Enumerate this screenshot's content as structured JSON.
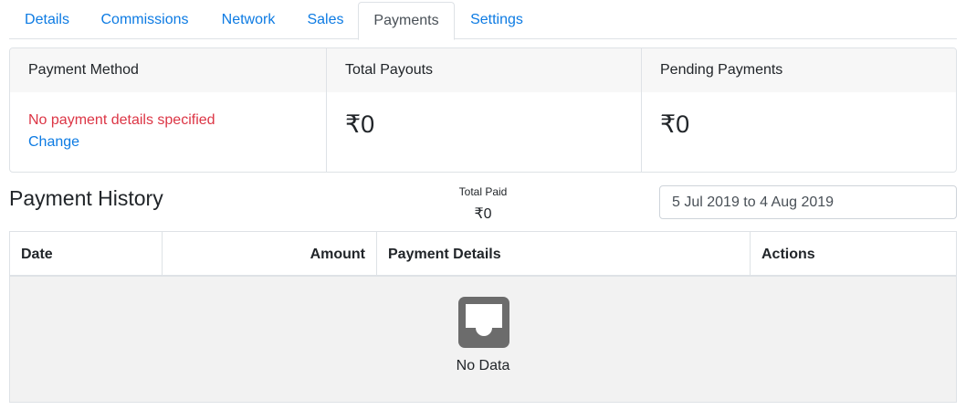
{
  "tabs": [
    {
      "label": "Details"
    },
    {
      "label": "Commissions"
    },
    {
      "label": "Network"
    },
    {
      "label": "Sales"
    },
    {
      "label": "Payments",
      "active": true
    },
    {
      "label": "Settings"
    }
  ],
  "summary": {
    "payment_method": {
      "heading": "Payment Method",
      "warning": "No payment details specified",
      "change_link": "Change"
    },
    "total_payouts": {
      "heading": "Total Payouts",
      "value": "₹0"
    },
    "pending_payments": {
      "heading": "Pending Payments",
      "value": "₹0"
    }
  },
  "history": {
    "title": "Payment History",
    "total_paid_label": "Total Paid",
    "total_paid_value": "₹0",
    "date_range": "5 Jul 2019 to 4 Aug 2019"
  },
  "table": {
    "columns": [
      "Date",
      "Amount",
      "Payment Details",
      "Actions"
    ],
    "rows": [],
    "empty_text": "No Data",
    "empty_icon": "inbox-icon"
  },
  "colors": {
    "link": "#0d7be3",
    "warning": "#dc3545",
    "empty_bg": "#f2f2f2",
    "icon": "#6c6c6c"
  }
}
